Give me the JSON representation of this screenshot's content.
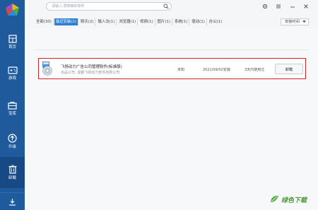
{
  "sidebar": {
    "items": [
      {
        "label": "首页",
        "icon": "home-icon"
      },
      {
        "label": "游戏",
        "icon": "gamepad-icon"
      },
      {
        "label": "宝库",
        "icon": "treasure-icon"
      },
      {
        "label": "升级",
        "icon": "upgrade-icon"
      },
      {
        "label": "卸载",
        "icon": "trash-icon",
        "active": true
      }
    ],
    "download_icon": "download-icon"
  },
  "search": {
    "placeholder": "请输入,想搜索的软件"
  },
  "filters": {
    "tabs": [
      {
        "label": "全部(30)"
      },
      {
        "label": "最近安装(2)",
        "active": true
      },
      {
        "label": "聊天(2)"
      },
      {
        "label": "输入法(1)"
      },
      {
        "label": "浏览器(1)"
      },
      {
        "label": "视频(1)"
      },
      {
        "label": "图片(1)"
      },
      {
        "label": "系统(1)"
      },
      {
        "label": "驱动(1)"
      },
      {
        "label": "办公(1)"
      }
    ],
    "sort_selected": "安装时间"
  },
  "apps": [
    {
      "name": "飞扬动力广告公司管理软件(标准版)",
      "company": "出品公司: 成都飞扬动力软件有限公司",
      "size": "未知",
      "install_date": "2021/09/02安装",
      "usage": "3天内使用过",
      "action_label": "卸载"
    }
  ],
  "watermark": {
    "text": "绿色下载"
  },
  "colors": {
    "sidebar_bg": "#1e5a9c",
    "sidebar_active": "#174a85",
    "accent": "#2d7fd3",
    "highlight_border": "#d2232a"
  }
}
